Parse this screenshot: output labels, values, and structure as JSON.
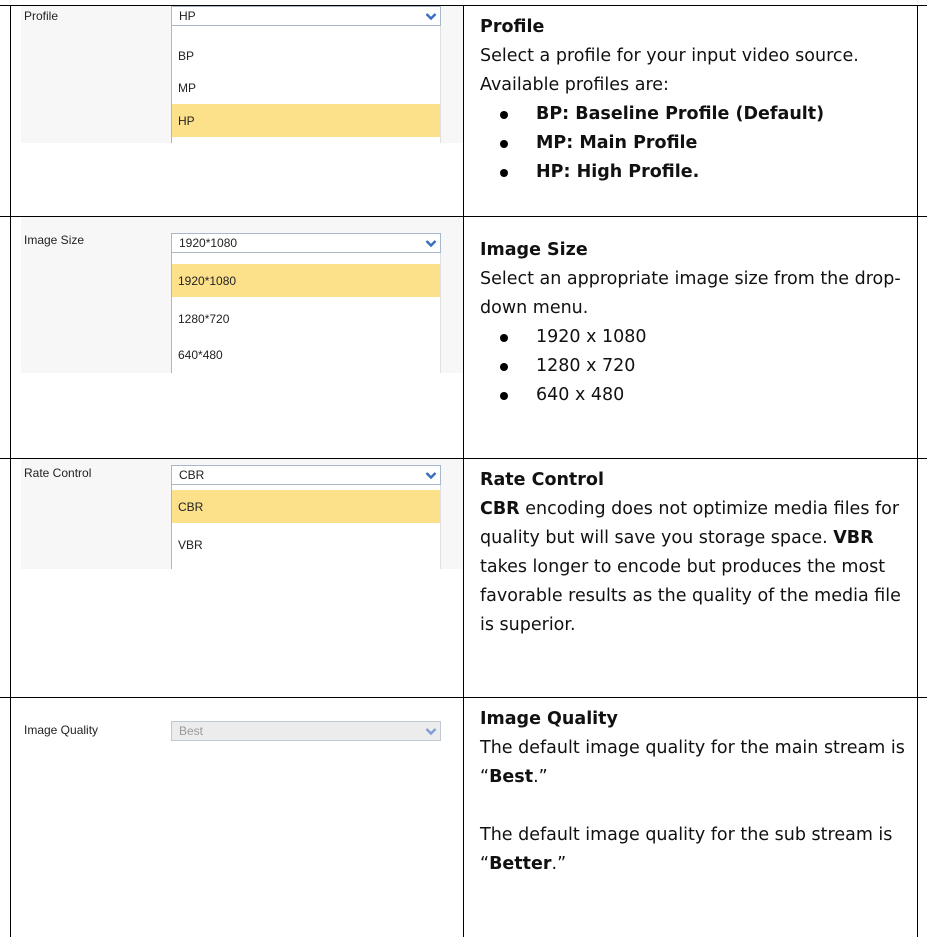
{
  "rows": [
    {
      "ui": {
        "label": "Profile",
        "selected": "HP",
        "options": [
          "BP",
          "MP",
          "HP"
        ],
        "highlighted": "HP"
      },
      "desc": {
        "title": "Profile",
        "text": "Select a profile for your input video source. Available profiles are:",
        "bullets": [
          "BP: Baseline Profile (Default)",
          "MP: Main Profile",
          "HP: High Profile."
        ]
      }
    },
    {
      "ui": {
        "label": "Image Size",
        "selected": "1920*1080",
        "options": [
          "1920*1080",
          "1280*720",
          "640*480"
        ],
        "highlighted": "1920*1080"
      },
      "desc": {
        "title": "Image Size",
        "text": "Select an appropriate image size from the drop-down menu.",
        "bullets": [
          "1920 x 1080",
          "1280 x 720",
          "640 x 480"
        ]
      }
    },
    {
      "ui": {
        "label": "Rate Control",
        "selected": "CBR",
        "options": [
          "CBR",
          "VBR"
        ],
        "highlighted": "CBR"
      },
      "desc": {
        "title": "Rate Control",
        "cbr": "CBR",
        "text_a": " encoding does not optimize media files for quality but will save you storage space. ",
        "vbr": "VBR",
        "text_b": " takes longer to encode but produces the most favorable results as the quality of the media file is superior."
      }
    },
    {
      "ui": {
        "label": "Image Quality",
        "selected": "Best",
        "disabled": true
      },
      "desc": {
        "title": "Image Quality",
        "p1_a": "The default image quality for the main stream is “",
        "p1_b": "Best",
        "p1_c": ".”",
        "p2_a": "The default image quality for the sub stream is “",
        "p2_b": "Better",
        "p2_c": ".”"
      }
    }
  ],
  "colors": {
    "highlight": "#fde18a",
    "select_border": "#a8b8cc",
    "arrow": "#3a6cc0"
  },
  "icons": {
    "dropdown_arrow": "chevron-down-icon"
  }
}
